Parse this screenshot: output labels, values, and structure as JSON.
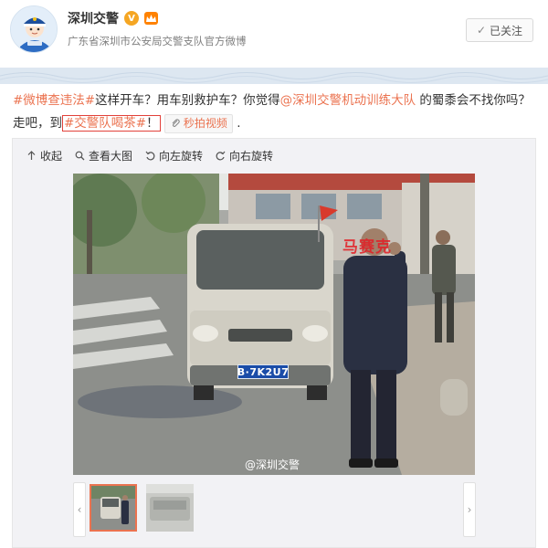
{
  "account": {
    "name": "深圳交警",
    "verified_mark": "V",
    "description": "广东省深圳市公安局交警支队官方微博",
    "follow_label": "已关注",
    "follow_icon": "checkmark-icon"
  },
  "post": {
    "segments": [
      {
        "text": "#微博查违法#",
        "type": "tag"
      },
      {
        "text": "这样开车？用车别救护车？你觉得",
        "type": "plain"
      },
      {
        "text": "@深圳交警机动训练大队",
        "type": "mention"
      },
      {
        "text": " 的蜀黍会不找你吗？走吧，到",
        "type": "plain"
      },
      {
        "text": "#交警队喝茶#",
        "type": "tag-boxed"
      },
      {
        "text": "！",
        "type": "plain-boxed"
      }
    ],
    "video_label": "秒拍视频",
    "trailing": " ."
  },
  "media": {
    "toolbar": [
      {
        "label": "收起",
        "icon": "arrow-up-icon"
      },
      {
        "label": "查看大图",
        "icon": "magnifier-icon"
      },
      {
        "label": "向左旋转",
        "icon": "rotate-left-icon"
      },
      {
        "label": "向右旋转",
        "icon": "rotate-right-icon"
      }
    ],
    "photo": {
      "plate_text": "B·7K2U7",
      "watermark": "@深圳交警",
      "scribble": "马赛克"
    },
    "thumbnails_count": 2,
    "accent_color": "#eb7350"
  }
}
